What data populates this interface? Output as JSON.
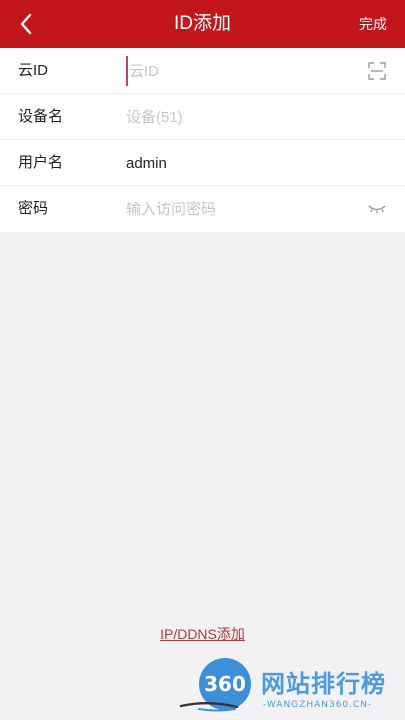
{
  "header": {
    "title": "ID添加",
    "done_label": "完成"
  },
  "form": {
    "cloud_id": {
      "label": "云ID",
      "value": "",
      "placeholder": "云ID",
      "icon": "scan-icon"
    },
    "device_name": {
      "label": "设备名",
      "value": "",
      "placeholder": "设备(51)"
    },
    "username": {
      "label": "用户名",
      "value": "admin",
      "placeholder": ""
    },
    "password": {
      "label": "密码",
      "value": "",
      "placeholder": "输入访问密码",
      "icon": "eye-closed-icon"
    }
  },
  "footer": {
    "ipddns_link": "IP/DDNS添加"
  },
  "watermark": {
    "badge": "360",
    "name": "网站排行榜",
    "url": "-WANGZHAN360.CN-"
  },
  "colors": {
    "header_bg": "#c3161c",
    "link": "#b33a3a",
    "watermark": "#4a9be0"
  }
}
